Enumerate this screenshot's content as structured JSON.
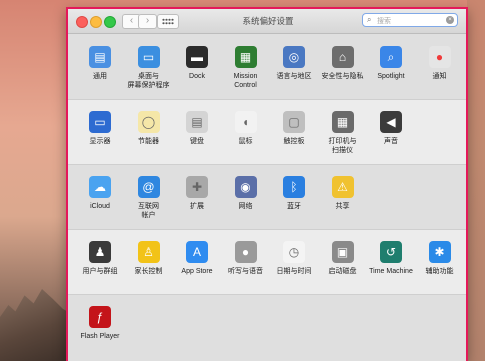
{
  "window": {
    "title": "系统偏好设置"
  },
  "nav": {
    "back": "‹",
    "forward": "›"
  },
  "search": {
    "placeholder": "搜索",
    "icon": "search-icon",
    "clear_icon": "clear-icon"
  },
  "rows": [
    [
      {
        "label": "通用",
        "icon": "general-icon",
        "color": "#4a90e2"
      },
      {
        "label": "桌面与\n屏幕保护程序",
        "icon": "desktop-screensaver-icon",
        "color": "#3b8fe0"
      },
      {
        "label": "Dock",
        "icon": "dock-icon",
        "color": "#2b2b2b"
      },
      {
        "label": "Mission\nControl",
        "icon": "mission-control-icon",
        "color": "#2e7d32"
      },
      {
        "label": "语言与地区",
        "icon": "language-region-icon",
        "color": "#4a78c2"
      },
      {
        "label": "安全性与隐私",
        "icon": "security-privacy-icon",
        "color": "#6d6d6d"
      },
      {
        "label": "Spotlight",
        "icon": "spotlight-icon",
        "color": "#3a86e8"
      },
      {
        "label": "通知",
        "icon": "notifications-icon",
        "color": "#e5e5e5"
      }
    ],
    [
      {
        "label": "显示器",
        "icon": "displays-icon",
        "color": "#2d6bd1"
      },
      {
        "label": "节能器",
        "icon": "energy-saver-icon",
        "color": "#f5e7a8"
      },
      {
        "label": "键盘",
        "icon": "keyboard-icon",
        "color": "#d4d4d4"
      },
      {
        "label": "鼠标",
        "icon": "mouse-icon",
        "color": "#f2f2f2"
      },
      {
        "label": "触控板",
        "icon": "trackpad-icon",
        "color": "#bfbfbf"
      },
      {
        "label": "打印机与\n扫描仪",
        "icon": "printers-scanners-icon",
        "color": "#6a6a6a"
      },
      {
        "label": "声音",
        "icon": "sound-icon",
        "color": "#3b3b3b"
      }
    ],
    [
      {
        "label": "iCloud",
        "icon": "icloud-icon",
        "color": "#4aa3f0"
      },
      {
        "label": "互联网\n帐户",
        "icon": "internet-accounts-icon",
        "color": "#2f87e0"
      },
      {
        "label": "扩展",
        "icon": "extensions-icon",
        "color": "#a8a8a8"
      },
      {
        "label": "网络",
        "icon": "network-icon",
        "color": "#5b6fa8"
      },
      {
        "label": "蓝牙",
        "icon": "bluetooth-icon",
        "color": "#2a7fe0"
      },
      {
        "label": "共享",
        "icon": "sharing-icon",
        "color": "#f0c230"
      }
    ],
    [
      {
        "label": "用户与群组",
        "icon": "users-groups-icon",
        "color": "#3a3a3a"
      },
      {
        "label": "家长控制",
        "icon": "parental-controls-icon",
        "color": "#f2c318"
      },
      {
        "label": "App Store",
        "icon": "app-store-icon",
        "color": "#2f8cf0"
      },
      {
        "label": "听写与语音",
        "icon": "dictation-speech-icon",
        "color": "#9a9a9a"
      },
      {
        "label": "日期与时间",
        "icon": "date-time-icon",
        "color": "#f4f4f4"
      },
      {
        "label": "启动磁盘",
        "icon": "startup-disk-icon",
        "color": "#8a8a8a"
      },
      {
        "label": "Time Machine",
        "icon": "time-machine-icon",
        "color": "#1f7e6e"
      },
      {
        "label": "辅助功能",
        "icon": "accessibility-icon",
        "color": "#2a8ae8"
      }
    ],
    [
      {
        "label": "Flash Player",
        "icon": "flash-player-icon",
        "color": "#c4141a"
      }
    ]
  ]
}
